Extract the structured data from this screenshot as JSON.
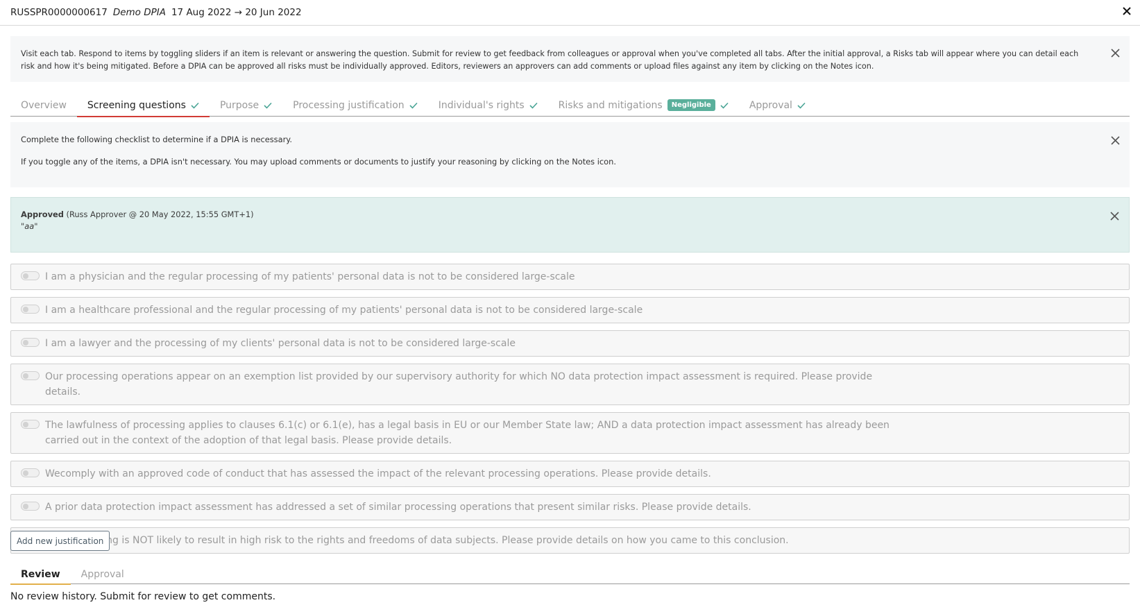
{
  "header": {
    "reference": "RUSSPR0000000617",
    "name": "Demo DPIA",
    "dates": "17 Aug 2022 → 20 Jun 2022"
  },
  "instructions": {
    "text": "Visit each tab. Respond to items by toggling sliders if an item is relevant or answering the question. Submit for review to get feedback from colleagues or approval when you've completed all tabs. After the initial approval, a Risks tab will appear where you can detail each risk and how it's being mitigated. Before a DPIA can be approved all risks must be individually approved. Editors, reviewers an approvers can add comments or upload files against any item by clicking on the Notes icon."
  },
  "tabs": [
    {
      "label": "Overview",
      "active": false,
      "checked": false
    },
    {
      "label": "Screening questions",
      "active": true,
      "checked": true
    },
    {
      "label": "Purpose",
      "active": false,
      "checked": true
    },
    {
      "label": "Processing justification",
      "active": false,
      "checked": true
    },
    {
      "label": "Individual's rights",
      "active": false,
      "checked": true
    },
    {
      "label": "Risks and mitigations",
      "active": false,
      "checked": true,
      "badge": "Negligible"
    },
    {
      "label": "Approval",
      "active": false,
      "checked": true
    }
  ],
  "checklist_info": {
    "line1": "Complete the following checklist to determine if a DPIA is necessary.",
    "line2": "If you toggle any of the items, a DPIA isn't necessary. You may upload comments or documents to justify your reasoning by clicking on the Notes icon."
  },
  "approval_notice": {
    "status": "Approved",
    "detail": " (Russ Approver @ 20 May 2022, 15:55 GMT+1)",
    "comment": "\"aa\""
  },
  "items": [
    {
      "text": "I am a physician and the regular processing of my patients' personal data is not to be considered large-scale",
      "on": false
    },
    {
      "text": "I am a healthcare professional and the regular processing of my patients' personal data is not to be considered large-scale",
      "on": false
    },
    {
      "text": "I am a lawyer and the processing of my clients' personal data is not to be considered large-scale",
      "on": false
    },
    {
      "text": "Our processing operations appear on an exemption list provided by our supervisory authority for which NO data protection impact assessment is required. Please provide details.",
      "on": false
    },
    {
      "text": "The lawfulness of processing applies to clauses 6.1(c) or 6.1(e), has a legal basis in EU or our Member State law; AND a data protection impact assessment has already been carried out in the context of the adoption of that legal basis. Please provide details.",
      "on": false
    },
    {
      "text": "Wecomply with an approved code of conduct that has assessed the impact of the relevant processing operations. Please provide details.",
      "on": false
    },
    {
      "text": "A prior data protection impact assessment has addressed a set of similar processing operations that present similar risks. Please provide details.",
      "on": false
    },
    {
      "text": "The processing is NOT likely to result in high risk to the rights and freedoms of data subjects. Please provide details on how you came to this conclusion.",
      "on": false
    }
  ],
  "add_button": "Add new justification",
  "subtabs": [
    {
      "label": "Review",
      "active": true
    },
    {
      "label": "Approval",
      "active": false
    }
  ],
  "history_text": "No review history. Submit for review to get comments.",
  "colors": {
    "active_tab_underline": "#d23b36",
    "check": "#4aa596",
    "badge": "#5aaf9b",
    "approved_bg": "#e1f0ee",
    "review_underline": "#e2b04a"
  }
}
